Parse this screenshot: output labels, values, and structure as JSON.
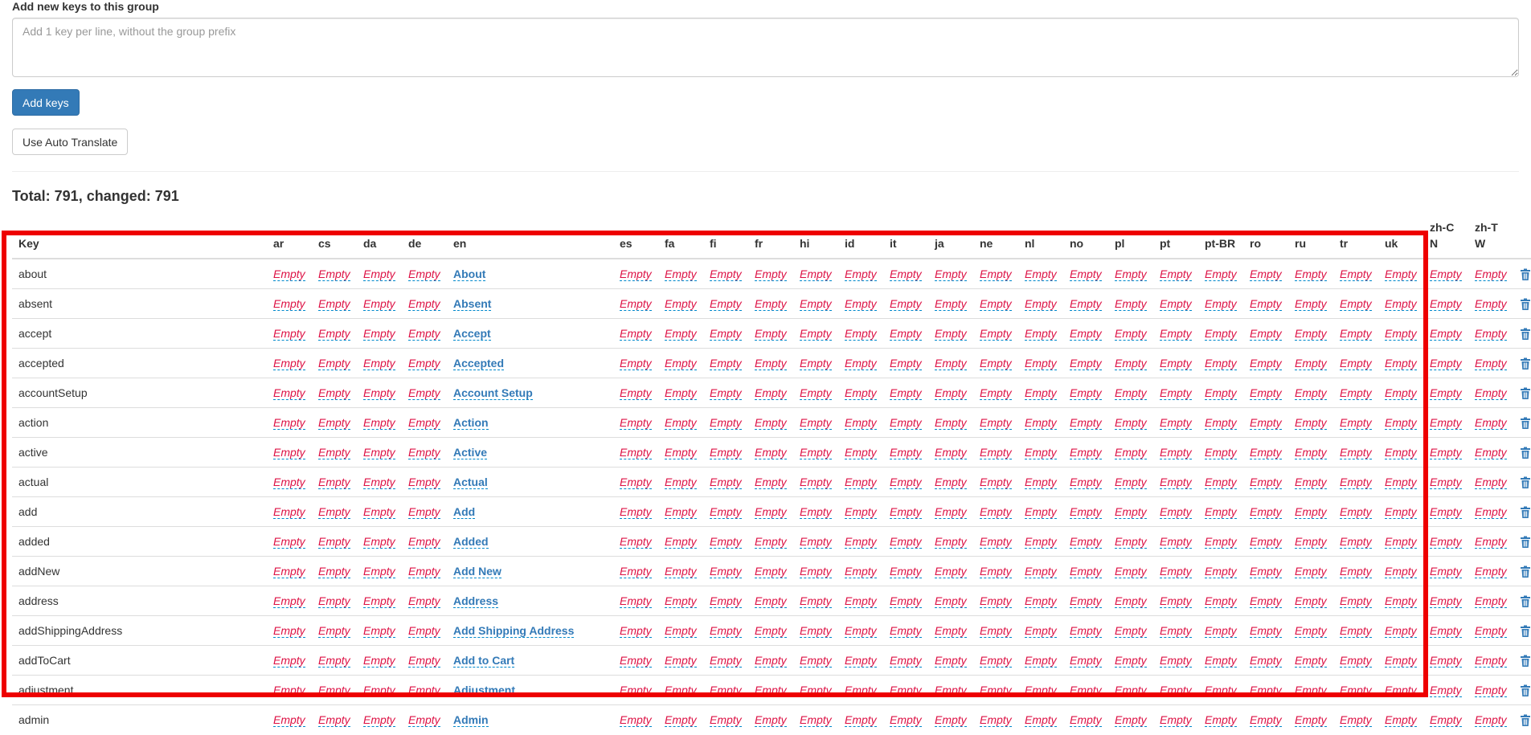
{
  "form": {
    "label": "Add new keys to this group",
    "placeholder": "Add 1 key per line, without the group prefix",
    "add_button": "Add keys",
    "auto_translate_button": "Use Auto Translate"
  },
  "summary": {
    "text": "Total: 791, changed: 791"
  },
  "table": {
    "key_header": "Key",
    "languages": [
      "ar",
      "cs",
      "da",
      "de",
      "en",
      "es",
      "fa",
      "fi",
      "fr",
      "hi",
      "id",
      "it",
      "ja",
      "ne",
      "nl",
      "no",
      "pl",
      "pt",
      "pt-BR",
      "ro",
      "ru",
      "tr",
      "uk",
      "zh-CN",
      "zh-TW"
    ],
    "empty_label": "Empty",
    "rows": [
      {
        "key": "about",
        "en": "About"
      },
      {
        "key": "absent",
        "en": "Absent"
      },
      {
        "key": "accept",
        "en": "Accept"
      },
      {
        "key": "accepted",
        "en": "Accepted"
      },
      {
        "key": "accountSetup",
        "en": "Account Setup"
      },
      {
        "key": "action",
        "en": "Action"
      },
      {
        "key": "active",
        "en": "Active"
      },
      {
        "key": "actual",
        "en": "Actual"
      },
      {
        "key": "add",
        "en": "Add"
      },
      {
        "key": "added",
        "en": "Added"
      },
      {
        "key": "addNew",
        "en": "Add New"
      },
      {
        "key": "address",
        "en": "Address"
      },
      {
        "key": "addShippingAddress",
        "en": "Add Shipping Address"
      },
      {
        "key": "addToCart",
        "en": "Add to Cart"
      },
      {
        "key": "adjustment",
        "en": "Adjustment"
      },
      {
        "key": "admin",
        "en": "Admin"
      }
    ]
  },
  "icons": {
    "delete": "trash-icon"
  },
  "colors": {
    "primary": "#337ab7",
    "empty": "#dd1144",
    "highlight": "#ee0000"
  }
}
